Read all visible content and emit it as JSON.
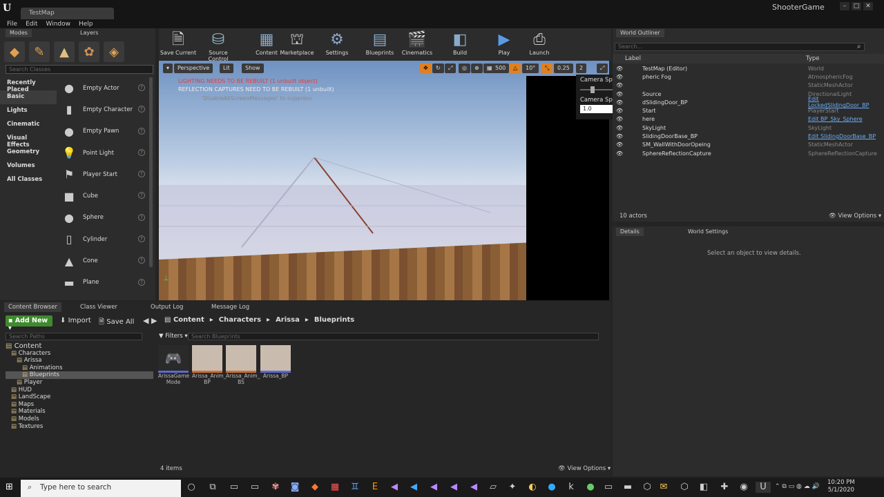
{
  "window": {
    "map_tab": "TestMap",
    "app_name": "ShooterGame"
  },
  "menu": [
    "File",
    "Edit",
    "Window",
    "Help"
  ],
  "left_tabs": [
    "Modes",
    "Layers"
  ],
  "class_search_placeholder": "Search Classes",
  "categories": [
    "Recently Placed",
    "Basic",
    "Lights",
    "Cinematic",
    "Visual Effects",
    "Geometry",
    "Volumes",
    "All Classes"
  ],
  "place_items": [
    "Empty Actor",
    "Empty Character",
    "Empty Pawn",
    "Point Light",
    "Player Start",
    "Cube",
    "Sphere",
    "Cylinder",
    "Cone",
    "Plane"
  ],
  "toolbar": [
    "Save Current",
    "Source Control",
    "Content",
    "Marketplace",
    "Settings",
    "Blueprints",
    "Cinematics",
    "Build",
    "Play",
    "Launch"
  ],
  "viewport": {
    "perspective": "Perspective",
    "lit": "Lit",
    "show": "Show",
    "grid": "500",
    "rot": "10°",
    "scale": "0.25",
    "cam": "2",
    "warn1": "LIGHTING NEEDS TO BE REBUILT (1 unbuilt object)",
    "warn2": "REFLECTION CAPTURES NEED TO BE REBUILT (1 unbuilt)",
    "warn3": "'DisableAllScreenMessages' to suppress"
  },
  "camera": {
    "speed_label": "Camera Speed",
    "speed_value": "2",
    "scalar_label": "Camera Speed Scalar",
    "scalar_value": "1.0",
    "slider": 0.15
  },
  "outliner": {
    "title": "World Outliner",
    "search_placeholder": "Search...",
    "col_label": "Label",
    "col_type": "Type",
    "rows": [
      {
        "label": "TestMap (Editor)",
        "type": "World",
        "link": false
      },
      {
        "label": "pheric Fog",
        "type": "AtmosphericFog",
        "link": false
      },
      {
        "label": "",
        "type": "StaticMeshActor",
        "link": false
      },
      {
        "label": "Source",
        "type": "DirectionalLight",
        "link": false
      },
      {
        "label": "dSlidingDoor_BP",
        "type": "Edit LockedSlidingDoor_BP",
        "link": true
      },
      {
        "label": "Start",
        "type": "PlayerStart",
        "link": false
      },
      {
        "label": "here",
        "type": "Edit BP_Sky_Sphere",
        "link": true
      },
      {
        "label": "SkyLight",
        "type": "SkyLight",
        "link": false
      },
      {
        "label": "SlidingDoorBase_BP",
        "type": "Edit SlidingDoorBase_BP",
        "link": true
      },
      {
        "label": "SM_WallWithDoorOpeing",
        "type": "StaticMeshActor",
        "link": false
      },
      {
        "label": "SphereReflectionCapture",
        "type": "SphereReflectionCapture",
        "link": false
      }
    ],
    "count": "10 actors",
    "view_options": "View Options"
  },
  "details": {
    "tab1": "Details",
    "tab2": "World Settings",
    "empty": "Select an object to view details."
  },
  "bottom_tabs": [
    "Content Browser",
    "Class Viewer",
    "Output Log",
    "Message Log"
  ],
  "content_browser": {
    "add_new": "Add New",
    "import": "Import",
    "save_all": "Save All",
    "breadcrumb": [
      "Content",
      "Characters",
      "Arissa",
      "Blueprints"
    ],
    "path_search": "Search Paths",
    "filters": "Filters",
    "bp_search": "Search Blueprints",
    "tree": [
      {
        "t": "Content",
        "d": 0
      },
      {
        "t": "Characters",
        "d": 1
      },
      {
        "t": "Arissa",
        "d": 2
      },
      {
        "t": "Animations",
        "d": 3
      },
      {
        "t": "Blueprints",
        "d": 3,
        "sel": true
      },
      {
        "t": "Player",
        "d": 2
      },
      {
        "t": "HUD",
        "d": 1
      },
      {
        "t": "LandScape",
        "d": 1
      },
      {
        "t": "Maps",
        "d": 1
      },
      {
        "t": "Materials",
        "d": 1
      },
      {
        "t": "Models",
        "d": 1
      },
      {
        "t": "Textures",
        "d": 1
      }
    ],
    "assets": [
      "ArissaGame Mode",
      "Arissa_Anim_ BP",
      "Arissa_Anim_ BS",
      "Arissa_BP"
    ],
    "items": "4 items",
    "view_options": "View Options"
  },
  "taskbar": {
    "search": "Type here to search",
    "time": "10:20 PM",
    "date": "5/1/2020"
  }
}
